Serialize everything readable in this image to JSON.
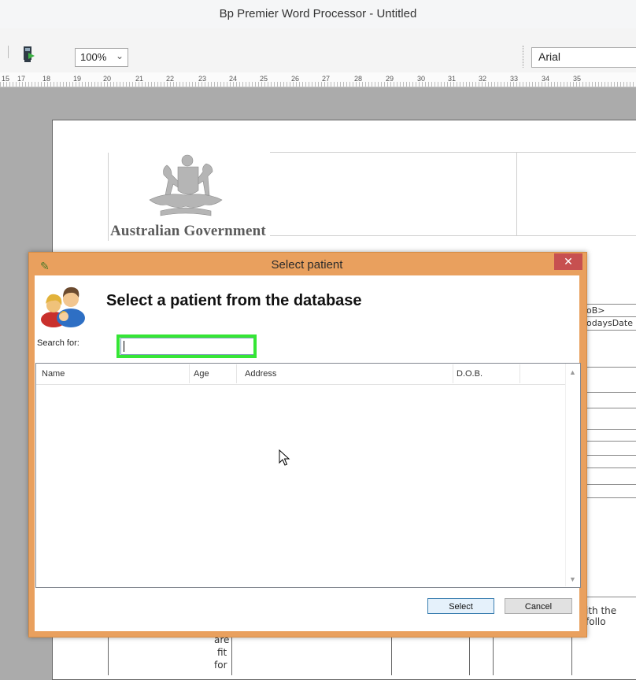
{
  "window": {
    "title": "Bp Premier Word Processor - Untitled"
  },
  "toolbar": {
    "zoom": {
      "value": "100%"
    },
    "font": {
      "value": "Arial"
    }
  },
  "ruler": {
    "numbers": [
      "15",
      "17",
      "18",
      "19",
      "20",
      "21",
      "22",
      "23",
      "24",
      "25",
      "26",
      "27",
      "28",
      "29",
      "30",
      "31",
      "32",
      "33",
      "34",
      "35"
    ]
  },
  "document": {
    "logo_text": "Australian Government",
    "fields": [
      "oB>",
      "odaysDate"
    ],
    "fragment_right": "ith the follo",
    "fragment_words": [
      "are",
      "fit",
      "for"
    ]
  },
  "dialog": {
    "title": "Select patient",
    "close_glyph": "✕",
    "heading": "Select a patient from the database",
    "search_label": "Search for:",
    "search_value": "",
    "columns": [
      "Name",
      "Age",
      "Address",
      "D.O.B."
    ],
    "rows": [],
    "buttons": {
      "select": "Select",
      "cancel": "Cancel"
    }
  },
  "icons": [
    "print-icon",
    "chevron-down-icon",
    "pencil-icon",
    "close-icon",
    "users-icon",
    "scroll-up-icon",
    "scroll-down-icon",
    "mouse-cursor-icon",
    "coat-of-arms-logo"
  ]
}
